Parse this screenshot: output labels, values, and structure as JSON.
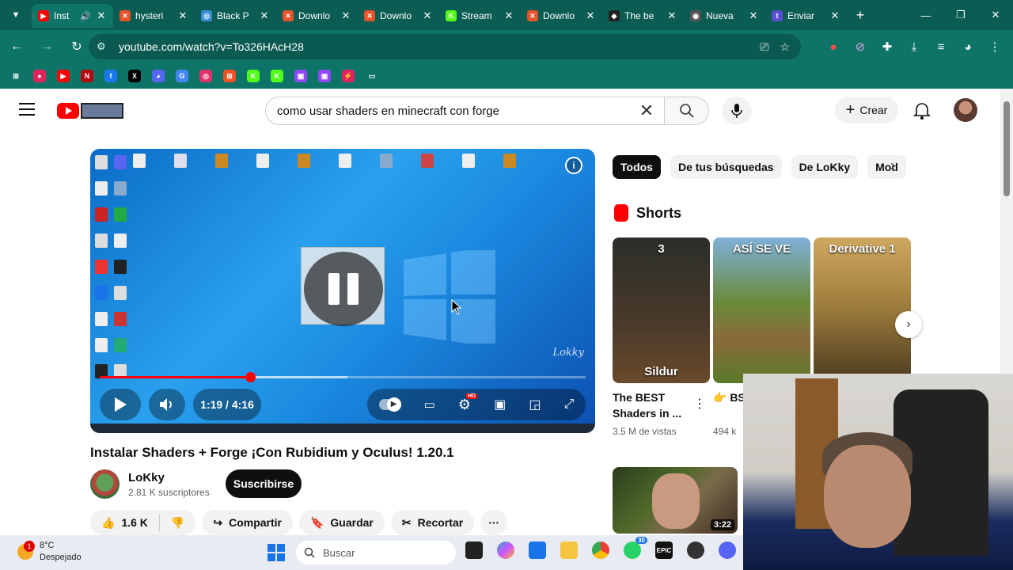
{
  "browser": {
    "tabs": [
      {
        "title": "Inst",
        "fav_color": "#ff0000",
        "fav_text": "▶",
        "active": true
      },
      {
        "title": "hysteri",
        "fav_color": "#e8542a",
        "fav_text": "✕",
        "active": false
      },
      {
        "title": "Black P",
        "fav_color": "#3a8fd8",
        "fav_text": "◎",
        "active": false
      },
      {
        "title": "Downlo",
        "fav_color": "#e8542a",
        "fav_text": "✕",
        "active": false
      },
      {
        "title": "Downlo",
        "fav_color": "#e8542a",
        "fav_text": "✕",
        "active": false
      },
      {
        "title": "Stream",
        "fav_color": "#53fc18",
        "fav_text": "K",
        "active": false
      },
      {
        "title": "Downlo",
        "fav_color": "#e8542a",
        "fav_text": "✕",
        "active": false
      },
      {
        "title": "The be",
        "fav_color": "#222222",
        "fav_text": "◆",
        "active": false
      },
      {
        "title": "Nueva",
        "fav_color": "#555555",
        "fav_text": "◉",
        "active": false
      },
      {
        "title": "Enviar",
        "fav_color": "#5a4fcf",
        "fav_text": "t",
        "active": false
      }
    ],
    "new_tab": "+",
    "url": "youtube.com/watch?v=To326HAcH28"
  },
  "bookmarks": [
    {
      "name": "apps",
      "color": "#0f7468",
      "text": "⊞"
    },
    {
      "name": "red-circle",
      "color": "#e0245e",
      "text": "●"
    },
    {
      "name": "youtube",
      "color": "#ff0000",
      "text": "▶"
    },
    {
      "name": "netflix",
      "color": "#b20710",
      "text": "N"
    },
    {
      "name": "facebook",
      "color": "#1877f2",
      "text": "f"
    },
    {
      "name": "x",
      "color": "#000000",
      "text": "X"
    },
    {
      "name": "discord",
      "color": "#5865f2",
      "text": "◕"
    },
    {
      "name": "translate",
      "color": "#4285f4",
      "text": "G"
    },
    {
      "name": "instagram",
      "color": "#e1306c",
      "text": "◎"
    },
    {
      "name": "microsoft",
      "color": "#f25022",
      "text": "⊞"
    },
    {
      "name": "kick",
      "color": "#53fc18",
      "text": "K"
    },
    {
      "name": "kick2",
      "color": "#53fc18",
      "text": "K"
    },
    {
      "name": "twitch",
      "color": "#9146ff",
      "text": "▣"
    },
    {
      "name": "twitch2",
      "color": "#9146ff",
      "text": "▣"
    },
    {
      "name": "bolt",
      "color": "#e0245e",
      "text": "⚡"
    },
    {
      "name": "folder",
      "color": "#0f7468",
      "text": "▭"
    }
  ],
  "youtube": {
    "search_query": "como usar shaders en minecraft con forge",
    "create_label": "Crear",
    "video": {
      "title": "Instalar Shaders + Forge ¡Con Rubidium y Oculus! 1.20.1",
      "time": "1:19 / 4:16",
      "progress": 0.31,
      "buffered": 0.51,
      "watermark": "Lokky",
      "info_icon": "i"
    },
    "channel": {
      "name": "LoKky",
      "subscribers": "2.81 K suscriptores",
      "subscribe_label": "Suscribirse"
    },
    "actions": {
      "likes": "1.6 K",
      "share": "Compartir",
      "save": "Guardar",
      "clip": "Recortar",
      "more": "···"
    },
    "chips": [
      "Todos",
      "De tus búsquedas",
      "De LoKky",
      "Mod"
    ],
    "shorts_heading": "Shorts",
    "shorts": [
      {
        "overlay_top": "3",
        "overlay_bottom": "Sildur",
        "title": "The BEST Shaders in ...",
        "views": "3.5 M de vistas",
        "bg": "linear-gradient(180deg,#2a2e2a,#4a3a2a 60%,#6a4a2a)"
      },
      {
        "overlay_top": "ASÍ SE VE",
        "overlay_bottom": "",
        "title": "👉 BS Shade",
        "views": "494 k",
        "bg": "linear-gradient(180deg,#7fb0d8,#6a8a3a 45%,#8a6a3a 70%,#5a7a2a)"
      },
      {
        "overlay_top": "Derivative 1",
        "overlay_bottom": "",
        "title": "",
        "views": "",
        "bg": "linear-gradient(180deg,#cfa860,#9a7a3a 50%,#4a3a20)"
      }
    ],
    "recommended": {
      "duration": "3:22"
    }
  },
  "taskbar": {
    "weather_temp": "8°C",
    "weather_desc": "Despejado",
    "weather_badge": "1",
    "search_placeholder": "Buscar",
    "whatsapp_count": "30"
  }
}
